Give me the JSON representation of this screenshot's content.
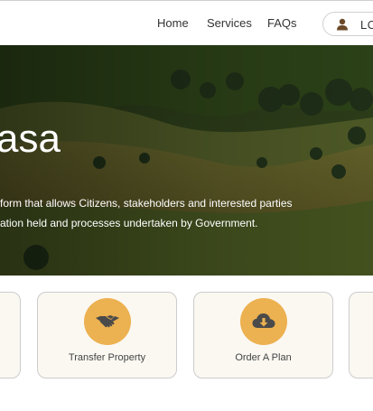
{
  "nav": {
    "home": "Home",
    "services": "Services",
    "faqs": "FAQs",
    "login": "LOGIN"
  },
  "hero": {
    "title": "asa",
    "desc_line1": "form that allows Citizens, stakeholders and interested parties",
    "desc_line2": "ation held and processes undertaken by Government."
  },
  "services": [
    {
      "label": "Transfer Property",
      "icon": "handshake-icon"
    },
    {
      "label": "Order A Plan",
      "icon": "cloud-download-icon"
    }
  ],
  "colors": {
    "accent": "#ecb150",
    "card_bg": "#fbf8f2",
    "icon_glyph": "#4a4a4a"
  }
}
